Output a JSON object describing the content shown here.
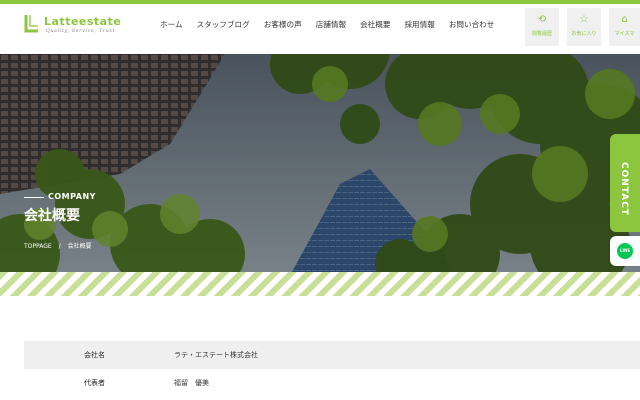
{
  "brand": {
    "name": "Latteestate",
    "tagline": "Quality, Service, Trust",
    "accent": "#8cc63f"
  },
  "nav": {
    "items": [
      "ホーム",
      "スタッフブログ",
      "お客様の声",
      "店舗情報",
      "会社概要",
      "採用情報",
      "お問い合わせ"
    ]
  },
  "side_buttons": [
    {
      "label": "閲覧履歴",
      "icon": "history-icon"
    },
    {
      "label": "お気に入り",
      "icon": "star-icon"
    },
    {
      "label": "マイスマ",
      "icon": "mypage-icon"
    }
  ],
  "hero": {
    "en": "COMPANY",
    "ja": "会社概要",
    "breadcrumb": [
      "TOPPAGE",
      "/",
      "会社概要"
    ]
  },
  "floating": {
    "contact": "CONTACT",
    "line": "LINE"
  },
  "company_table": [
    {
      "label": "会社名",
      "value": "ラテ・エステート株式会社"
    },
    {
      "label": "代表者",
      "value": "福留　優美"
    }
  ]
}
